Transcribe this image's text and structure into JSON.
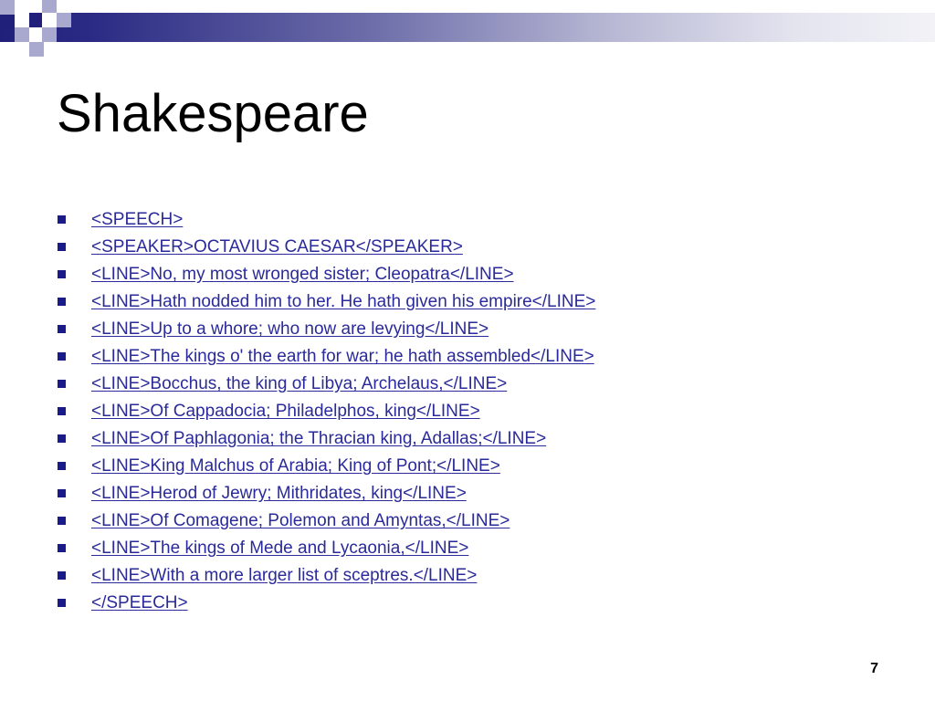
{
  "slide": {
    "title": "Shakespeare",
    "page_number": "7",
    "accent_color": "#1a1a88",
    "link_color": "#2a2a9a"
  },
  "bullets": [
    "<SPEECH>",
    "<SPEAKER>OCTAVIUS CAESAR</SPEAKER>",
    "<LINE>No, my most wronged sister; Cleopatra</LINE>",
    "<LINE>Hath nodded him to her. He hath given his empire</LINE>",
    "<LINE>Up to a whore; who now are levying</LINE>",
    "<LINE>The kings o' the earth for war; he hath assembled</LINE>",
    "<LINE>Bocchus, the king of Libya; Archelaus,</LINE>",
    "<LINE>Of Cappadocia; Philadelphos, king</LINE>",
    "<LINE>Of Paphlagonia; the Thracian king, Adallas;</LINE>",
    "<LINE>King Malchus of Arabia; King of Pont;</LINE>",
    "<LINE>Herod of Jewry; Mithridates, king</LINE>",
    "<LINE>Of Comagene; Polemon and Amyntas,</LINE>",
    "<LINE>The kings of Mede and Lycaonia,</LINE>",
    "<LINE>With a more larger list of sceptres.</LINE>",
    "</SPEECH>"
  ]
}
